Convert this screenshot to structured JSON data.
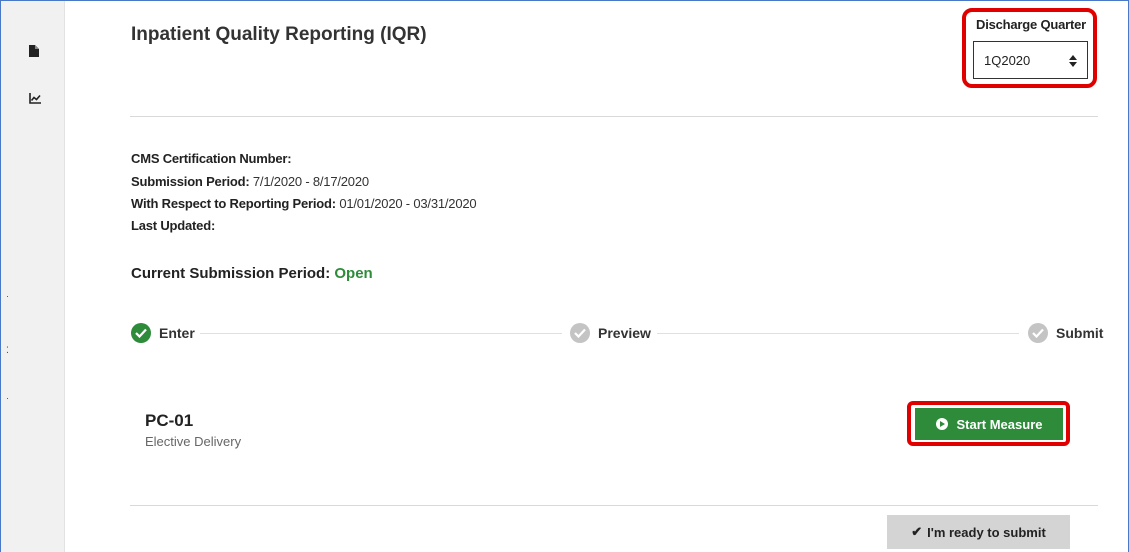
{
  "header": {
    "title": "Inpatient Quality Reporting (IQR)"
  },
  "discharge_quarter": {
    "label": "Discharge Quarter",
    "value": "1Q2020"
  },
  "info": {
    "ccn_label": "CMS Certification Number:",
    "ccn_value": "",
    "submission_period_label": "Submission Period:",
    "submission_period_value": "7/1/2020 - 8/17/2020",
    "reporting_period_label": "With Respect to Reporting Period:",
    "reporting_period_value": "01/01/2020 - 03/31/2020",
    "last_updated_label": "Last Updated:",
    "last_updated_value": ""
  },
  "current_period": {
    "label": "Current Submission Period:",
    "status": "Open",
    "status_color": "#2e8b3a"
  },
  "steps": [
    {
      "label": "Enter",
      "state": "complete"
    },
    {
      "label": "Preview",
      "state": "incomplete"
    },
    {
      "label": "Submit",
      "state": "incomplete"
    }
  ],
  "measure": {
    "code": "PC-01",
    "description": "Elective Delivery",
    "start_label": "Start Measure"
  },
  "ready_button": {
    "label": "I'm ready to submit"
  },
  "sidebar": {
    "icons": [
      "document-icon",
      "chart-icon"
    ]
  },
  "colors": {
    "accent_green": "#2e8b3a",
    "highlight_red": "#e00000"
  }
}
